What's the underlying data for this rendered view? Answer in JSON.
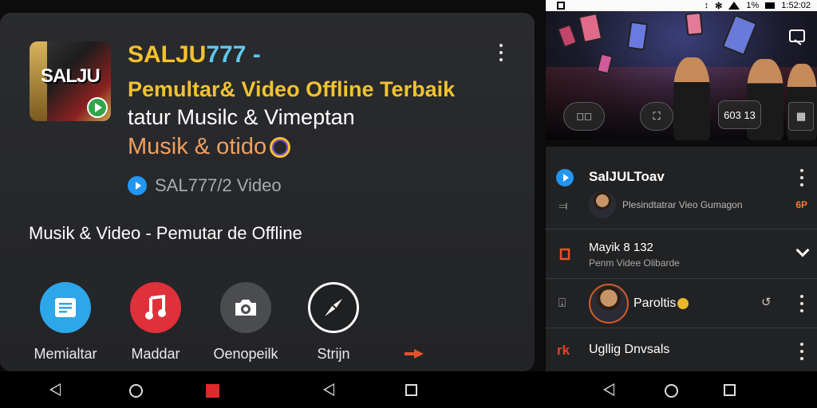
{
  "card": {
    "icon_text": "SALJU",
    "title_part1": "SALJU",
    "title_part2": "777 -",
    "subtitle_line1": "Pemultar& Video Offline Terbaik",
    "subtitle_line2": "tatur Musilc & Vimeptan",
    "subtitle_line3": "Musik & otido",
    "developer": "SAL777/2 Video",
    "description": "Musik & Video - Pemutar de Offline",
    "actions": [
      {
        "label": "Memialtar",
        "icon": "list-doc-icon",
        "color": "#2ea6ea"
      },
      {
        "label": "Maddar",
        "icon": "music-note-icon",
        "color": "#e0303a"
      },
      {
        "label": "Oenopeilk",
        "icon": "camera-icon",
        "color": "#4b4c50"
      },
      {
        "label": "Strijn",
        "icon": "share-compass-icon",
        "color": "#ffffff"
      }
    ]
  },
  "status_bar": {
    "time": "1:52:02",
    "battery": "1%"
  },
  "video": {
    "counter": "603 13"
  },
  "list": {
    "header": "SalJULToav",
    "row2_text": "Plesindtatrar Vieo Gumagon",
    "row2_badge": "6P",
    "row3_title": "Mayik 8 132",
    "row3_subtitle": "Penm Videe Olibarde",
    "row4_name": "Paroltis",
    "row5_glyph": "rk",
    "row5_text": "Ugllig Dnvsals"
  },
  "colors": {
    "accent_yellow": "#f2c230",
    "accent_blue": "#2196f3",
    "accent_red": "#e0303a",
    "accent_orange": "#ff7a2a"
  }
}
